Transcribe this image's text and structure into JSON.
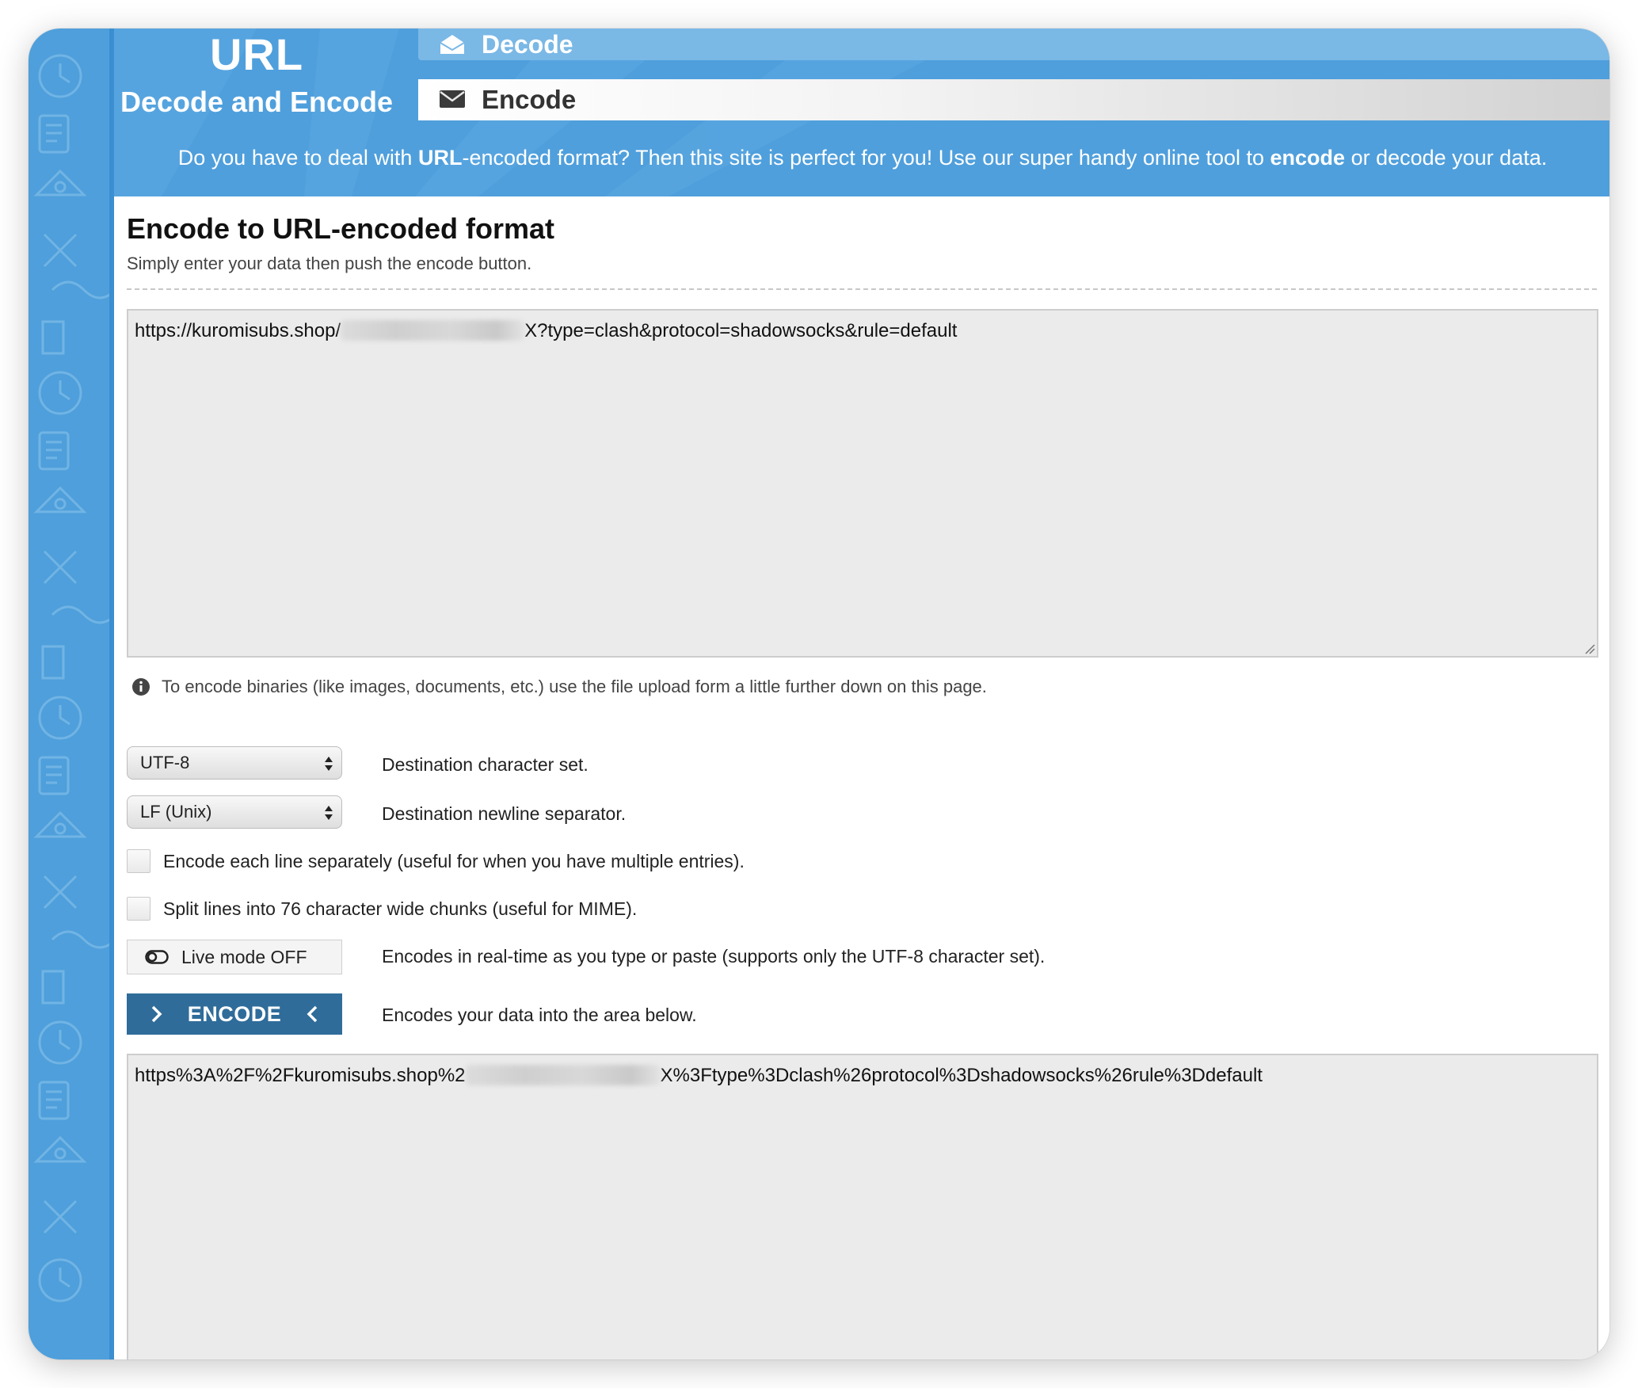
{
  "header": {
    "logo_title": "URL",
    "logo_subtitle": "Decode and Encode",
    "tabs": [
      {
        "label": "Decode",
        "icon": "envelope-open-icon"
      },
      {
        "label": "Encode",
        "icon": "envelope-icon"
      }
    ],
    "intro": {
      "part1": "Do you have to deal with ",
      "bold1": "URL",
      "part2": "-encoded format? Then this site is perfect for you! Use our super handy online tool to ",
      "bold2": "encode",
      "part3": " or decode your data."
    }
  },
  "main": {
    "title": "Encode to URL-encoded format",
    "subtitle": "Simply enter your data then push the encode button.",
    "input": {
      "prefix": "https://kuromisubs.shop/",
      "suffix": "X?type=clash&protocol=shadowsocks&rule=default"
    },
    "info_text": "To encode binaries (like images, documents, etc.) use the file upload form a little further down on this page.",
    "charset": {
      "value": "UTF-8",
      "label": "Destination character set."
    },
    "newline": {
      "value": "LF (Unix)",
      "label": "Destination newline separator."
    },
    "options": [
      {
        "label": "Encode each line separately (useful for when you have multiple entries).",
        "checked": false
      },
      {
        "label": "Split lines into 76 character wide chunks (useful for MIME).",
        "checked": false
      }
    ],
    "live_mode": {
      "label": "Live mode OFF",
      "description": "Encodes in real-time as you type or paste (supports only the UTF-8 character set)."
    },
    "encode_button": {
      "label": "ENCODE",
      "description": "Encodes your data into the area below."
    },
    "output": {
      "prefix": "https%3A%2F%2Fkuromisubs.shop%2",
      "suffix": "X%3Ftype%3Dclash%26protocol%3Dshadowsocks%26rule%3Ddefault"
    }
  },
  "colors": {
    "header_blue": "#4f9fdc",
    "button_blue": "#2f6c9a",
    "textarea_bg": "#ebebeb"
  }
}
